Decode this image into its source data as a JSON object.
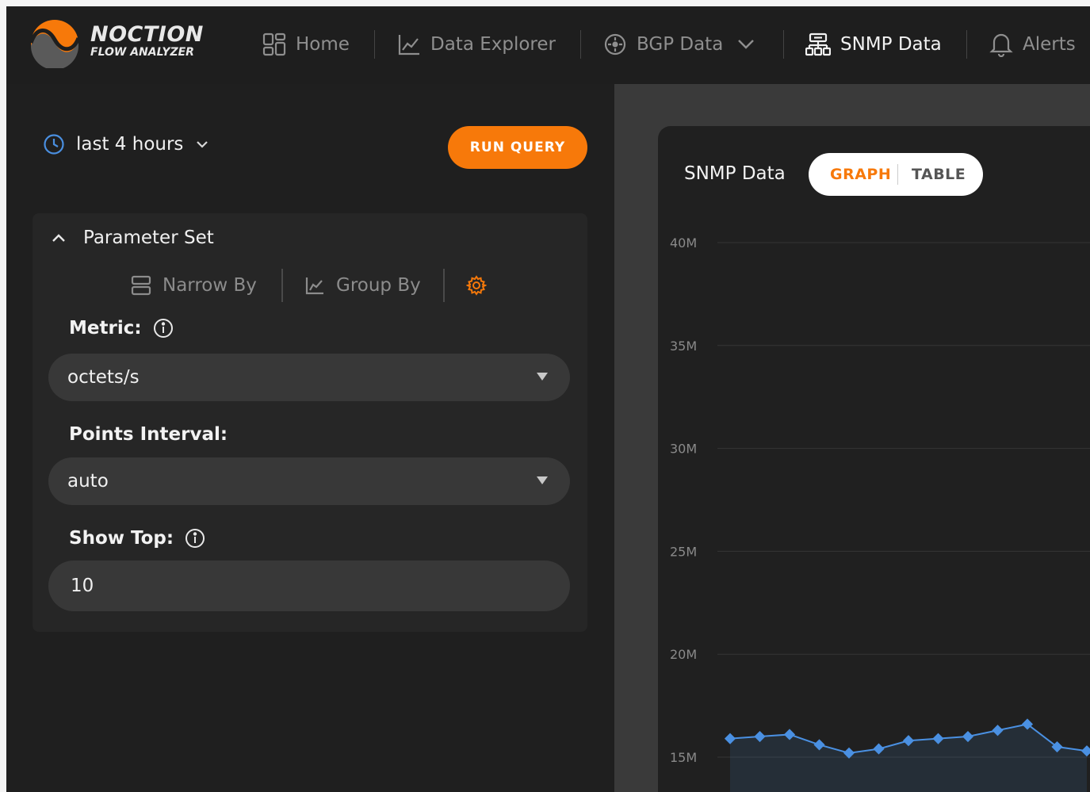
{
  "brand": {
    "name": "NOCTION",
    "subtitle": "FLOW ANALYZER"
  },
  "nav": {
    "home": "Home",
    "data_explorer": "Data Explorer",
    "bgp_data": "BGP Data",
    "snmp_data": "SNMP Data",
    "alerts": "Alerts",
    "active": "SNMP Data"
  },
  "toolbar": {
    "time_range": "last 4 hours",
    "run_query": "RUN QUERY"
  },
  "parameter_set": {
    "title": "Parameter Set",
    "tabs": {
      "narrow_by": "Narrow By",
      "group_by": "Group By"
    },
    "metric": {
      "label": "Metric:",
      "value": "octets/s"
    },
    "points_interval": {
      "label": "Points Interval:",
      "value": "auto"
    },
    "show_top": {
      "label": "Show Top:",
      "value": "10"
    }
  },
  "chart_panel": {
    "title": "SNMP Data",
    "view_toggle": {
      "graph": "GRAPH",
      "table": "TABLE",
      "selected": "GRAPH"
    }
  },
  "colors": {
    "accent": "#f7790a",
    "series": "#4a90e2",
    "background": "#1f1f1f"
  },
  "chart_data": {
    "type": "area",
    "title": "",
    "xlabel": "",
    "ylabel": "",
    "y_ticks": [
      "40M",
      "35M",
      "30M",
      "25M",
      "20M",
      "15M"
    ],
    "y_tick_values": [
      40000000,
      35000000,
      30000000,
      25000000,
      20000000,
      15000000
    ],
    "ylim": [
      15000000,
      40000000
    ],
    "grid": true,
    "series": [
      {
        "values": [
          15900000,
          16000000,
          16100000,
          15600000,
          15200000,
          15400000,
          15800000,
          15900000,
          16000000,
          16300000,
          16600000,
          15500000,
          15300000
        ]
      }
    ]
  }
}
